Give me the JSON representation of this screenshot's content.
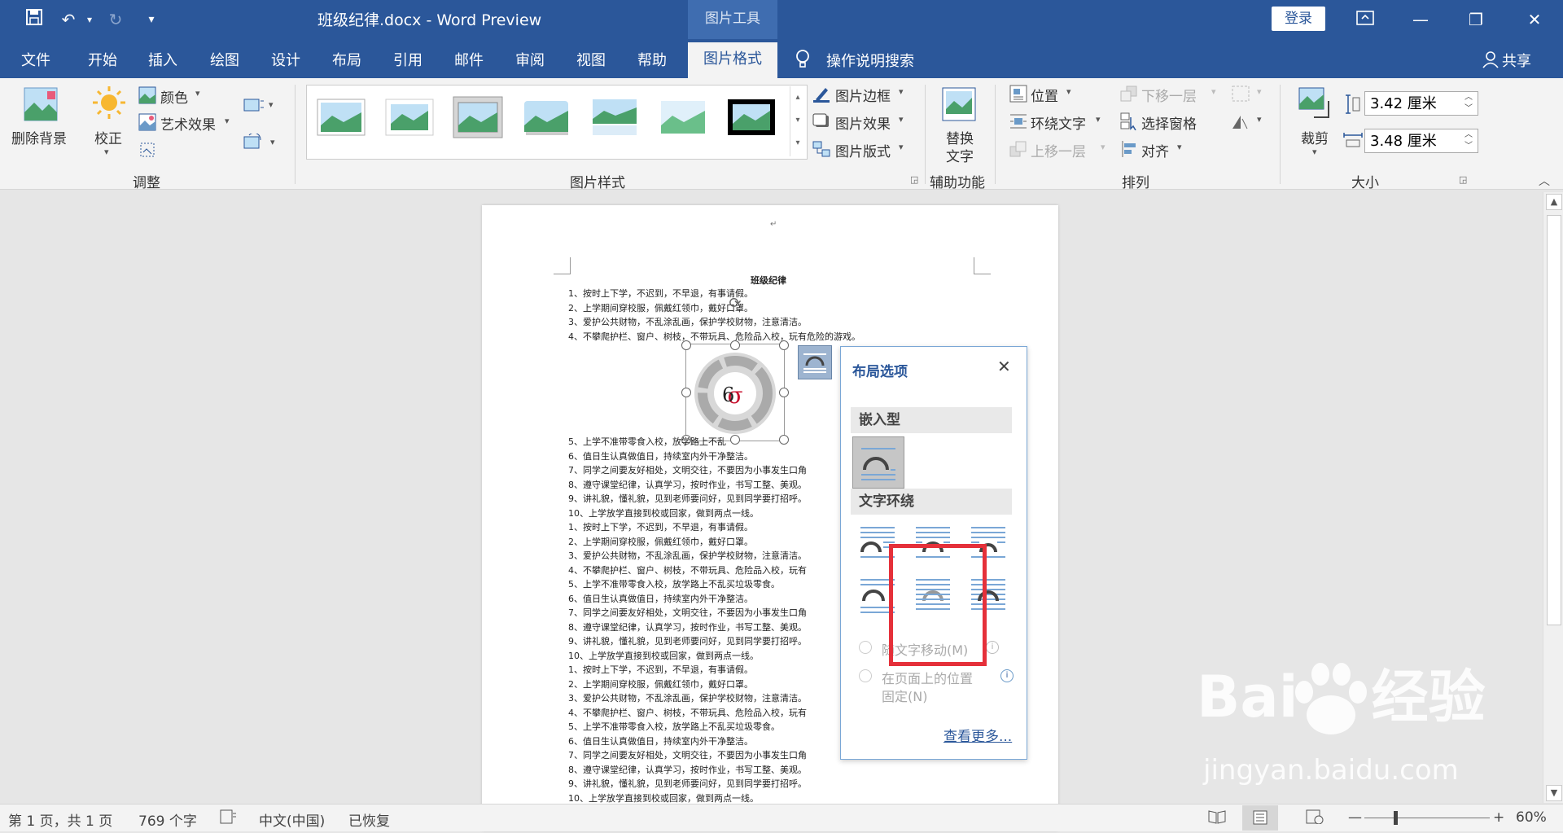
{
  "app": {
    "doc_title": "班级纪律.docx  -  Word Preview",
    "context_tab_group": "图片工具",
    "login_label": "登录"
  },
  "tabs": [
    "文件",
    "开始",
    "插入",
    "绘图",
    "设计",
    "布局",
    "引用",
    "邮件",
    "审阅",
    "视图",
    "帮助"
  ],
  "active_tab": "图片格式",
  "tell_me": "操作说明搜索",
  "share": "共享",
  "ribbon": {
    "adjust": {
      "remove_bg": "删除背景",
      "corrections": "校正",
      "color": "颜色",
      "artistic": "艺术效果",
      "group_label": "调整"
    },
    "styles": {
      "border": "图片边框",
      "effects": "图片效果",
      "layout": "图片版式",
      "group_label": "图片样式"
    },
    "accessibility": {
      "alt_text_line1": "替换",
      "alt_text_line2": "文字",
      "group_label": "辅助功能"
    },
    "arrange": {
      "position": "位置",
      "wrap_text": "环绕文字",
      "bring_forward": "上移一层",
      "send_backward": "下移一层",
      "selection_pane": "选择窗格",
      "align": "对齐",
      "group_label": "排列"
    },
    "size": {
      "crop": "裁剪",
      "height": "3.42 厘米",
      "width": "3.48 厘米",
      "group_label": "大小"
    }
  },
  "document": {
    "title": "班级纪律",
    "lines": [
      "1、按时上下学，不迟到，不早退，有事请假。",
      "2、上学期间穿校服，佩戴红领巾，戴好口罩。",
      "3、爱护公共财物，不乱涂乱画，保护学校财物，注意清洁。",
      "4、不攀爬护栏、窗户、树枝，不带玩具、危险品入校，玩有危险的游戏。",
      "5、上学不准带零食入校，放学路上不乱",
      "6、值日生认真做值日，持续室内外干净整洁。",
      "7、同学之间要友好相处，文明交往，不要因为小事发生口角",
      "8、遵守课堂纪律，认真学习，按时作业，书写工整、美观。",
      "9、讲礼貌，懂礼貌，见到老师要问好，见到同学要打招呼。",
      "10、上学放学直接到校或回家，做到两点一线。",
      "1、按时上下学，不迟到，不早退，有事请假。",
      "2、上学期间穿校服，佩戴红领巾，戴好口罩。",
      "3、爱护公共财物，不乱涂乱画，保护学校财物，注意清洁。",
      "4、不攀爬护栏、窗户、树枝，不带玩具、危险品入校，玩有",
      "5、上学不准带零食入校，放学路上不乱买垃圾零食。",
      "6、值日生认真做值日，持续室内外干净整洁。",
      "7、同学之间要友好相处，文明交往，不要因为小事发生口角",
      "8、遵守课堂纪律，认真学习，按时作业，书写工整、美观。",
      "9、讲礼貌，懂礼貌，见到老师要问好，见到同学要打招呼。",
      "10、上学放学直接到校或回家，做到两点一线。",
      "1、按时上下学，不迟到，不早退，有事请假。",
      "2、上学期间穿校服，佩戴红领巾，戴好口罩。",
      "3、爱护公共财物，不乱涂乱画，保护学校财物，注意清洁。",
      "4、不攀爬护栏、窗户、树枝，不带玩具、危险品入校，玩有",
      "5、上学不准带零食入校，放学路上不乱买垃圾零食。",
      "6、值日生认真做值日，持续室内外干净整洁。",
      "7、同学之间要友好相处，文明交往，不要因为小事发生口角",
      "8、遵守课堂纪律，认真学习，按时作业，书写工整、美观。",
      "9、讲礼貌，懂礼貌，见到老师要问好，见到同学要打招呼。",
      "10、上学放学直接到校或回家，做到两点一线。"
    ]
  },
  "layout_panel": {
    "title": "布局选项",
    "inline_section": "嵌入型",
    "wrap_section": "文字环绕",
    "move_with_text": "随文字移动(M)",
    "fix_position_line1": "在页面上的位置",
    "fix_position_line2": "固定(N)",
    "see_more": "查看更多..."
  },
  "status": {
    "page": "第 1 页，共 1 页",
    "words": "769 个字",
    "language": "中文(中国)",
    "recovered": "已恢复",
    "zoom": "60%"
  },
  "watermark": {
    "brand": "Bai",
    "brand_cn": "经验",
    "url": "jingyan.baidu.com"
  },
  "colors": {
    "word_blue": "#2b579a",
    "highlight_red": "#e5303a"
  }
}
